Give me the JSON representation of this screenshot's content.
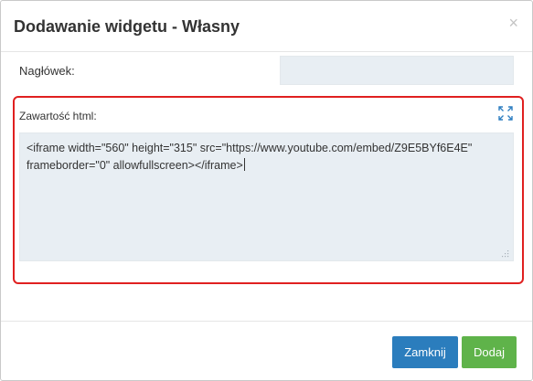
{
  "dialog": {
    "title": "Dodawanie widgetu - Własny",
    "close_symbol": "×"
  },
  "form": {
    "header_label": "Nagłówek:",
    "header_value": "",
    "html_label": "Zawartość html:",
    "html_value_line1": "<iframe width=\"560\" height=\"315\" src=\"https://www.youtube.com/embed/Z9E5BYf6E4E\"",
    "html_value_line2": "frameborder=\"0\" allowfullscreen></iframe>"
  },
  "buttons": {
    "close_label": "Zamknij",
    "add_label": "Dodaj"
  },
  "icons": {
    "expand": "expand-icon",
    "close": "close-icon",
    "resize": "resize-grip-icon"
  },
  "colors": {
    "close_button": "#2b7dbd",
    "add_button": "#5fb34a",
    "highlight_border": "#e02020",
    "input_background": "#e8eef3"
  }
}
